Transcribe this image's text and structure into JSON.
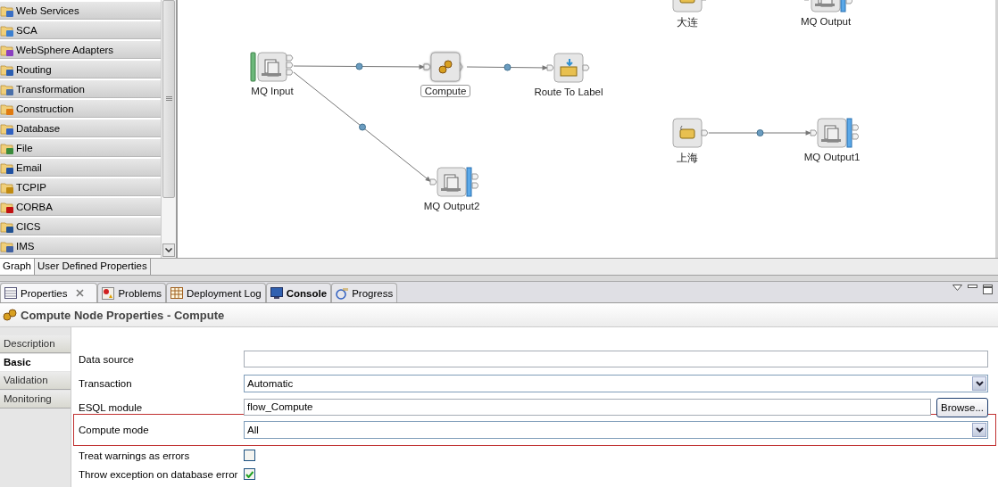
{
  "palette": {
    "drawers": [
      {
        "label": "Web Services"
      },
      {
        "label": "SCA"
      },
      {
        "label": "WebSphere Adapters"
      },
      {
        "label": "Routing"
      },
      {
        "label": "Transformation"
      },
      {
        "label": "Construction"
      },
      {
        "label": "Database"
      },
      {
        "label": "File"
      },
      {
        "label": "Email"
      },
      {
        "label": "TCPIP"
      },
      {
        "label": "CORBA"
      },
      {
        "label": "CICS"
      },
      {
        "label": "IMS"
      }
    ]
  },
  "canvas": {
    "nodes": [
      {
        "label": "大连",
        "kind": "label",
        "selected": false
      },
      {
        "label": "MQ Output",
        "kind": "output",
        "selected": false
      },
      {
        "label": "MQ Input",
        "kind": "input",
        "selected": false
      },
      {
        "label": "Compute",
        "kind": "compute",
        "selected": true
      },
      {
        "label": "Route To Label",
        "kind": "route",
        "selected": false
      },
      {
        "label": "上海",
        "kind": "label",
        "selected": false
      },
      {
        "label": "MQ Output1",
        "kind": "output",
        "selected": false
      },
      {
        "label": "MQ Output2",
        "kind": "output",
        "selected": false
      }
    ]
  },
  "editor_tabs": [
    {
      "label": "Graph",
      "selected": true
    },
    {
      "label": "User Defined Properties",
      "selected": false
    }
  ],
  "views": {
    "tabs": [
      {
        "label": "Properties",
        "selected": true,
        "updated": false
      },
      {
        "label": "Problems",
        "selected": false,
        "updated": false
      },
      {
        "label": "Deployment Log",
        "selected": false,
        "updated": false
      },
      {
        "label": "Console",
        "selected": false,
        "updated": true
      },
      {
        "label": "Progress",
        "selected": false,
        "updated": false
      }
    ]
  },
  "properties": {
    "title": "Compute Node Properties - Compute",
    "sections": [
      {
        "label": "Description",
        "selected": false
      },
      {
        "label": "Basic",
        "selected": true
      },
      {
        "label": "Validation",
        "selected": false
      },
      {
        "label": "Monitoring",
        "selected": false
      }
    ],
    "fields": [
      {
        "label": "Data source",
        "kind": "text",
        "highlighted": false
      },
      {
        "label": "Transaction",
        "kind": "combo",
        "value": "Automatic",
        "highlighted": false
      },
      {
        "label": "ESQL module",
        "kind": "text",
        "value": "flow_Compute",
        "button": "Browse...",
        "highlighted": false
      },
      {
        "label": "Compute mode",
        "kind": "combo",
        "value": "All",
        "highlighted": true
      },
      {
        "label": "Treat warnings as errors",
        "kind": "checkbox",
        "checked": false,
        "highlighted": false
      },
      {
        "label": "Throw exception on database error",
        "kind": "checkbox",
        "checked": true,
        "highlighted": false
      }
    ]
  }
}
